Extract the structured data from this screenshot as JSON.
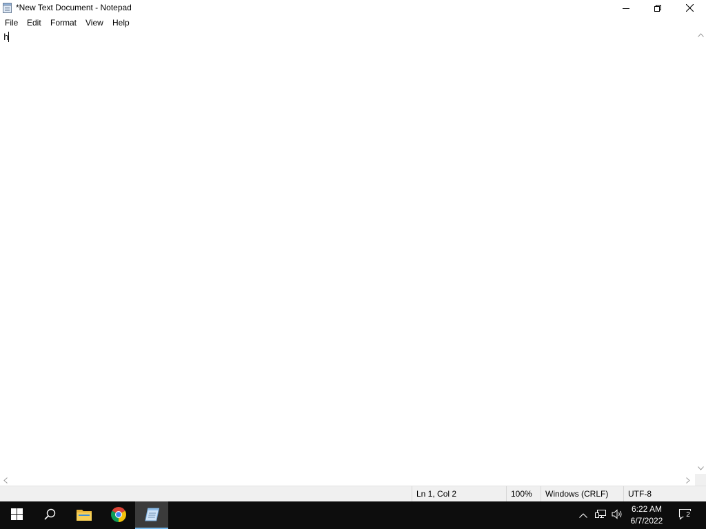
{
  "window": {
    "title": "*New Text Document - Notepad",
    "icons": {
      "app": "notepad-icon",
      "minimize": "minimize-icon",
      "restore": "restore-icon",
      "close": "close-icon"
    }
  },
  "menu": {
    "items": [
      {
        "label": "File"
      },
      {
        "label": "Edit"
      },
      {
        "label": "Format"
      },
      {
        "label": "View"
      },
      {
        "label": "Help"
      }
    ]
  },
  "editor": {
    "content": "h"
  },
  "status": {
    "position": "Ln 1, Col 2",
    "zoom": "100%",
    "line_ending": "Windows (CRLF)",
    "encoding": "UTF-8"
  },
  "taskbar": {
    "apps": [
      {
        "icon": "windows-start-icon"
      },
      {
        "icon": "search-icon"
      },
      {
        "icon": "file-explorer-icon"
      },
      {
        "icon": "chrome-icon"
      },
      {
        "icon": "notepad-icon",
        "active": true
      }
    ],
    "tray_icons": [
      "chevron-up-icon",
      "network-icon",
      "volume-icon"
    ],
    "clock": {
      "time": "6:22 AM",
      "date": "6/7/2022"
    },
    "notifications": {
      "icon": "action-center-icon",
      "count": "2"
    }
  },
  "colors": {
    "taskbar_bg": "#0d0d0d",
    "active_underline": "#76b9ed",
    "statusbar_bg": "#f0f0f0"
  }
}
